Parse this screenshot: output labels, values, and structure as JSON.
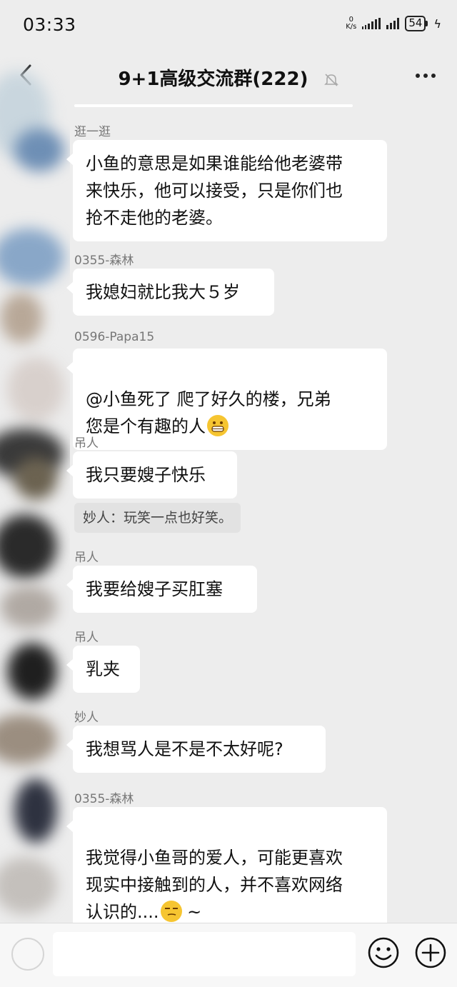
{
  "status_bar": {
    "time": "03:33",
    "net_speed_value": "0",
    "net_speed_unit": "K/s",
    "battery": "54"
  },
  "header": {
    "title": "9+1高级交流群(222)",
    "icons": [
      "back-icon",
      "mute-icon",
      "more-icon"
    ]
  },
  "messages": [
    {
      "sender": "逛一逛",
      "text": "小鱼的意思是如果谁能给他老婆带\n来快乐，他可以接受，只是你们也\n抢不走他的老婆。"
    },
    {
      "sender": "0355-森林",
      "text": "我媳妇就比我大５岁"
    },
    {
      "sender": "0596-Papa15",
      "text": "@小鱼死了  爬了好久的楼，兄弟\n您是个有趣的人",
      "emoji": "grinning-face-icon"
    },
    {
      "sender": "吊人",
      "text": "我只要嫂子快乐",
      "quote": "妙人：玩笑一点也好笑。"
    },
    {
      "sender": "吊人",
      "text": "我要给嫂子买肛塞"
    },
    {
      "sender": "吊人",
      "text": "乳夹"
    },
    {
      "sender": "妙人",
      "text": "我想骂人是不是不太好呢?"
    },
    {
      "sender": "0355-森林",
      "text": "我觉得小鱼哥的爱人，可能更喜欢\n现实中接触到的人，并不喜欢网络\n认识的....",
      "emoji": "smirk-face-icon",
      "suffix": " ~"
    }
  ],
  "input_bar": {
    "placeholder": "",
    "icons": [
      "voice-icon",
      "emoji-icon",
      "plus-icon"
    ]
  }
}
